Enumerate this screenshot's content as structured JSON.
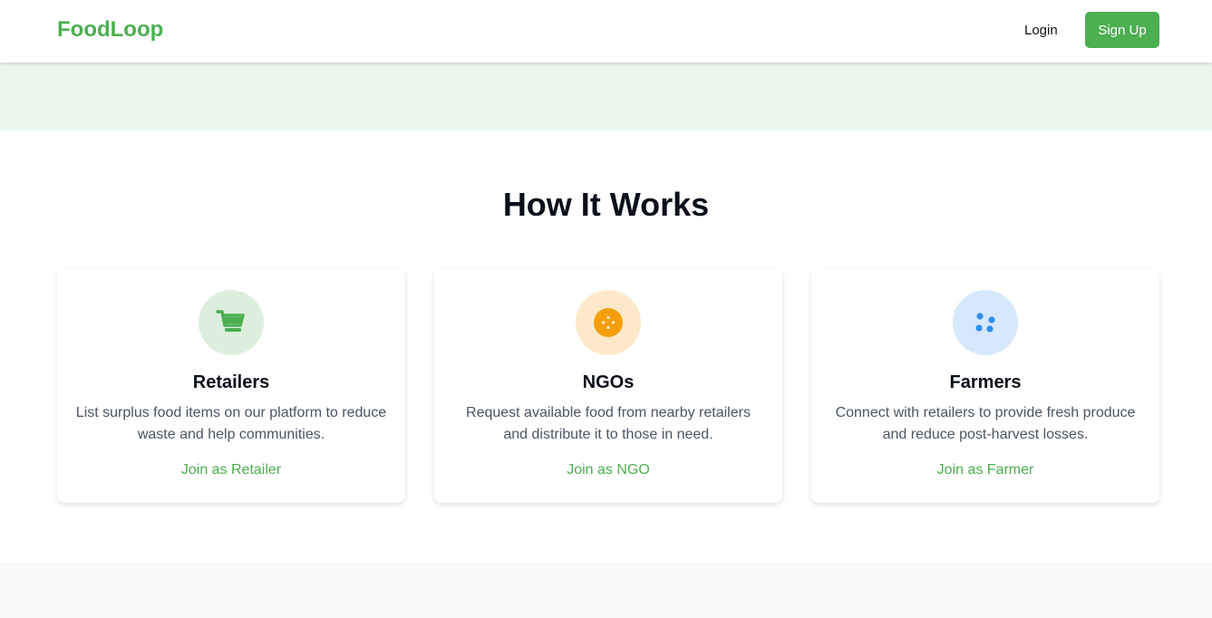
{
  "navbar": {
    "logo": "FoodLoop",
    "login_label": "Login",
    "signup_label": "Sign Up"
  },
  "how_it_works": {
    "title": "How It Works",
    "cards": [
      {
        "title": "Retailers",
        "description": "List surplus food items on our platform to reduce waste and help communities.",
        "link": "Join as Retailer",
        "icon": "shopping-cart-icon",
        "icon_color": "#4caf50",
        "icon_bg": "#dcefdc"
      },
      {
        "title": "NGOs",
        "description": "Request available food from nearby retailers and distribute it to those in need.",
        "link": "Join as NGO",
        "icon": "donation-icon",
        "icon_color": "#f59e0b",
        "icon_bg": "#fde9c9"
      },
      {
        "title": "Farmers",
        "description": "Connect with retailers to provide fresh produce and reduce post-harvest losses.",
        "link": "Join as Farmer",
        "icon": "seeds-icon",
        "icon_color": "#2f8ef0",
        "icon_bg": "#d6e8fb"
      }
    ]
  },
  "colors": {
    "brand": "#4caf50",
    "hero_bg": "#ebf5eb",
    "footer_bg": "#f8f9fb"
  }
}
